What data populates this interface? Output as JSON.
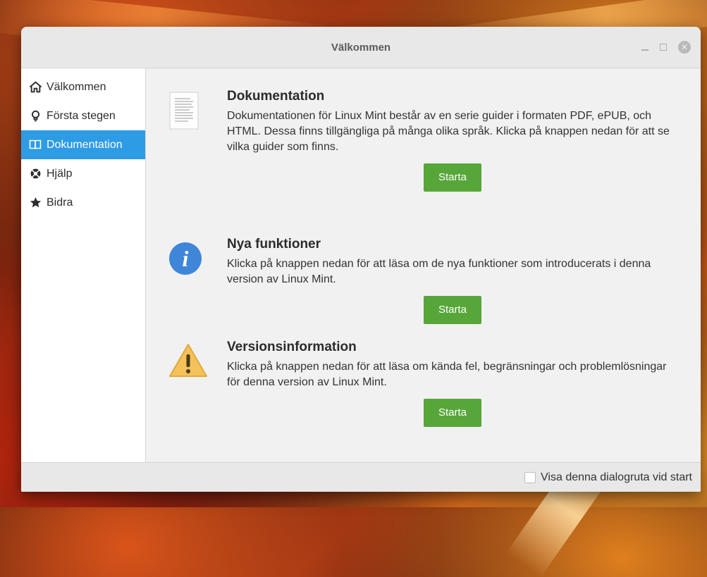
{
  "window": {
    "title": "Välkommen",
    "controls": {
      "close": "✕"
    }
  },
  "sidebar": {
    "items": [
      {
        "label": "Välkommen",
        "icon": "home-icon",
        "active": false
      },
      {
        "label": "Första stegen",
        "icon": "lightbulb-icon",
        "active": false
      },
      {
        "label": "Dokumentation",
        "icon": "book-icon",
        "active": true
      },
      {
        "label": "Hjälp",
        "icon": "lifebuoy-icon",
        "active": false
      },
      {
        "label": "Bidra",
        "icon": "star-icon",
        "active": false
      }
    ]
  },
  "sections": [
    {
      "title": "Dokumentation",
      "description": "Dokumentationen för Linux Mint består av en serie guider i formaten PDF, ePUB, och HTML. Dessa finns tillgängliga på många olika språk. Klicka på knappen nedan för att se vilka guider som finns.",
      "button": "Starta",
      "icon": "document-icon"
    },
    {
      "title": "Nya funktioner",
      "description": "Klicka på knappen nedan för att läsa om de nya funktioner som introducerats i denna version av Linux Mint.",
      "button": "Starta",
      "icon": "info-icon"
    },
    {
      "title": "Versionsinformation",
      "description": "Klicka på knappen nedan för att läsa om kända fel, begränsningar och problemlösningar för denna version av Linux Mint.",
      "button": "Starta",
      "icon": "warning-icon"
    }
  ],
  "footer": {
    "checkbox_label": "Visa denna dialogruta vid start",
    "checked": false
  },
  "colors": {
    "accent": "#2e9be5",
    "button": "#57a63a"
  }
}
